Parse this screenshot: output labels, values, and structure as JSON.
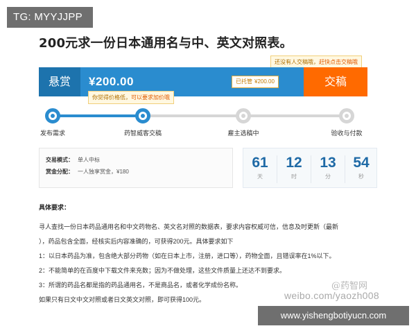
{
  "overlay": {
    "tag": "TG: MYYJJPP",
    "weibo_brand": "@药智网",
    "weibo_url": "weibo.com/yaozh008",
    "site_url": "www.yishengbotiyucn.com"
  },
  "page": {
    "title": "200元求一份日本通用名与中、英文对照表。"
  },
  "hints": {
    "top_prefix": "还没有人交稿哦，",
    "top_link": "赶快点击交稿哦",
    "bottom_prefix": "你觉得价格低，",
    "bottom_link": "可以要求加价哦"
  },
  "reward": {
    "label": "悬赏",
    "amount": "¥200.00",
    "hosted_label": "已托管",
    "hosted_amount": "¥200.00",
    "submit_label": "交稿"
  },
  "steps": [
    {
      "label": "发布需求",
      "done": true
    },
    {
      "label": "药智威客交稿",
      "done": true
    },
    {
      "label": "雇主选稿中",
      "done": false
    },
    {
      "label": "验收与付款",
      "done": false
    }
  ],
  "info": {
    "mode_key": "交易模式：",
    "mode_value": "单人中标",
    "alloc_key": "赏金分配：",
    "alloc_value": "一人独享赏金，¥180"
  },
  "countdown": [
    {
      "value": "61",
      "unit": "天"
    },
    {
      "value": "12",
      "unit": "时"
    },
    {
      "value": "13",
      "unit": "分"
    },
    {
      "value": "54",
      "unit": "秒"
    }
  ],
  "requirements": {
    "heading": "具体要求：",
    "lines": [
      "寻人查找一份日本药品通用名和中文药物名、英文名对照的数据表，要求内容权威可信，信息及时更新（最新",
      "），药品包含全面，经核实后内容准确的，可获得200元。具体要求如下",
      "1：以日本药品为准，包含绝大部分药物（如在日本上市，注册，进口等），药物全面，且错误率在1%以下。",
      "2：不能简单的在百度中下载文件来充数；因为不做处理，这些文件质量上还达不到要求。",
      "3：所谓的药品名都是指的药品通用名，不是商品名，或者化学成份名称。",
      "如果只有日文中文对照或者日文英文对照，即可获得100元。"
    ]
  },
  "colors": {
    "primary_blue": "#2a8ccf",
    "dark_blue": "#1d73ad",
    "accent_orange": "#ff6a00",
    "step_inactive": "#d6d6d6"
  }
}
